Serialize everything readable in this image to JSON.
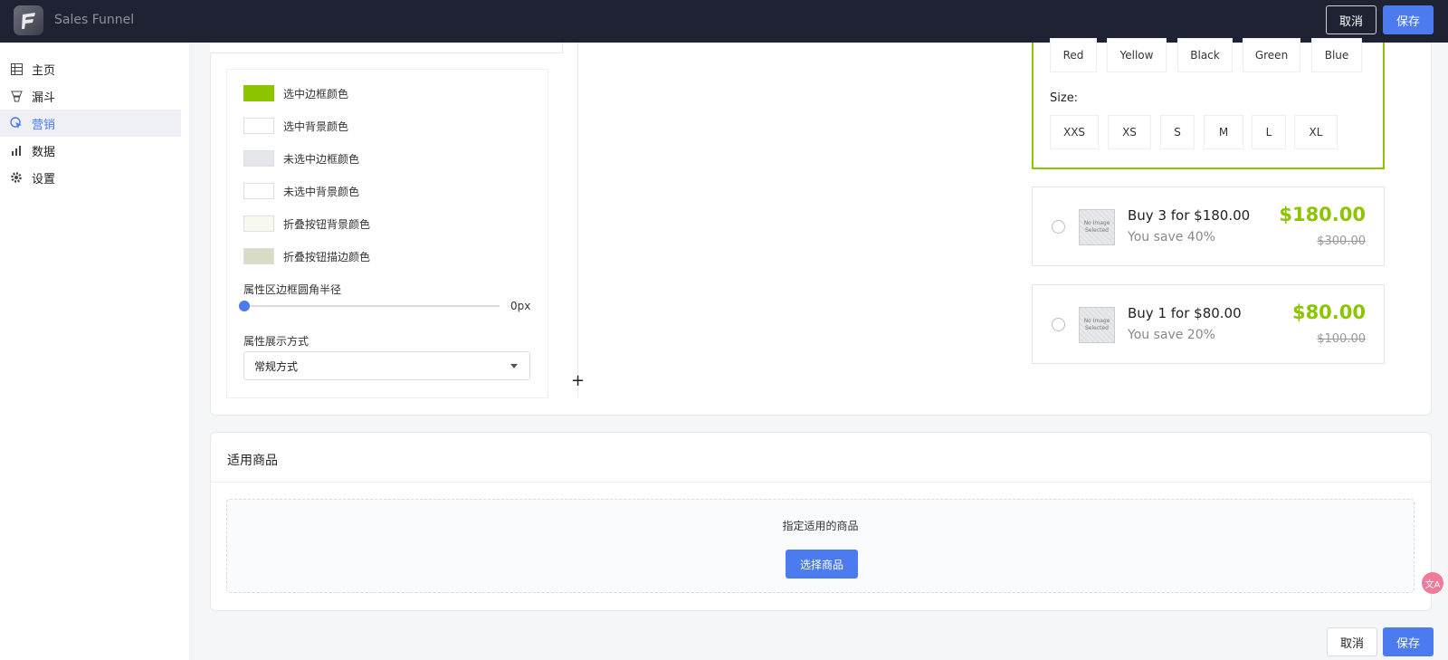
{
  "app": {
    "title": "Sales Funnel"
  },
  "header": {
    "cancel_label": "取消",
    "save_label": "保存"
  },
  "sidebar": {
    "items": [
      {
        "label": "主页",
        "icon": "table-icon",
        "active": false
      },
      {
        "label": "漏斗",
        "icon": "funnel-icon",
        "active": false
      },
      {
        "label": "营销",
        "icon": "cursor-click-icon",
        "active": true
      },
      {
        "label": "数据",
        "icon": "bar-chart-icon",
        "active": false
      },
      {
        "label": "设置",
        "icon": "gear-icon",
        "active": false
      }
    ]
  },
  "settings": {
    "colors": [
      {
        "label": "选中边框颜色",
        "color": "#8cc400"
      },
      {
        "label": "选中背景颜色",
        "color": "#ffffff"
      },
      {
        "label": "未选中边框颜色",
        "color": "#e4e6ea"
      },
      {
        "label": "未选中背景颜色",
        "color": "#ffffff"
      },
      {
        "label": "折叠按钮背景颜色",
        "color": "#f7f9ee"
      },
      {
        "label": "折叠按钮描边颜色",
        "color": "#d9dcc4"
      }
    ],
    "radius": {
      "label": "属性区边框圆角半径",
      "value_text": "0px",
      "value": 0
    },
    "display_mode": {
      "label": "属性展示方式",
      "selected": "常规方式"
    }
  },
  "preview": {
    "colors": [
      "Red",
      "Yellow",
      "Black",
      "Green",
      "Blue"
    ],
    "size_label": "Size:",
    "sizes": [
      "XXS",
      "XS",
      "S",
      "M",
      "L",
      "XL"
    ],
    "offers": [
      {
        "title": "Buy 3 for $180.00",
        "save": "You save 40%",
        "price": "$180.00",
        "old_price": "$300.00",
        "thumb": "No Image Selected"
      },
      {
        "title": "Buy 1 for $80.00",
        "save": "You save 20%",
        "price": "$80.00",
        "old_price": "$100.00",
        "thumb": "No Image Selected"
      }
    ]
  },
  "products": {
    "title": "适用商品",
    "hint": "指定适用的商品",
    "button_label": "选择商品"
  },
  "footer": {
    "cancel_label": "取消",
    "save_label": "保存"
  },
  "theme": {
    "accent": "#4b7bef",
    "selected_border": "#8cc400",
    "price": "#8cc400"
  }
}
